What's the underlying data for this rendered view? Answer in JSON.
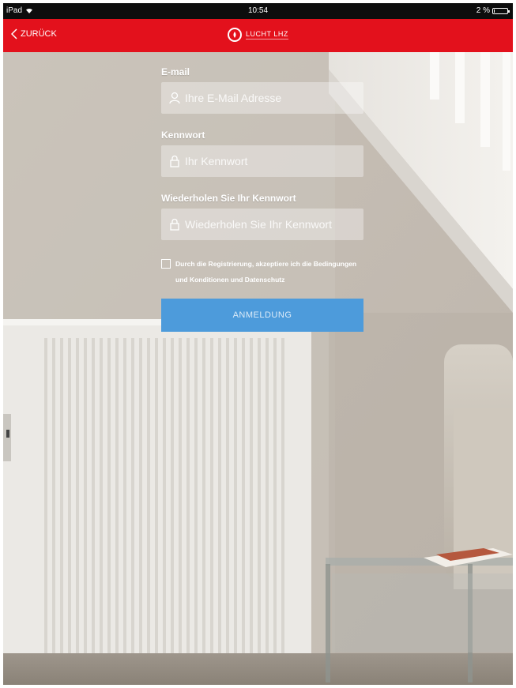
{
  "status_bar": {
    "device": "iPad",
    "time": "10:54",
    "battery": "2 %"
  },
  "nav": {
    "back_label": "ZURÜCK",
    "brand": "LUCHT LHZ"
  },
  "form": {
    "email_label": "E-mail",
    "email_placeholder": "Ihre E-Mail Adresse",
    "password_label": "Kennwort",
    "password_placeholder": "Ihr Kennwort",
    "repeat_label": "Wiederholen Sie Ihr Kennwort",
    "repeat_placeholder": "Wiederholen Sie Ihr Kennwort",
    "terms_text": "Durch die Registrierung, akzeptiere ich die Bedingungen und Konditionen und Datenschutz",
    "submit_label": "ANMELDUNG"
  },
  "colors": {
    "navbar": "#e3111c",
    "button": "#4d9bdb"
  }
}
